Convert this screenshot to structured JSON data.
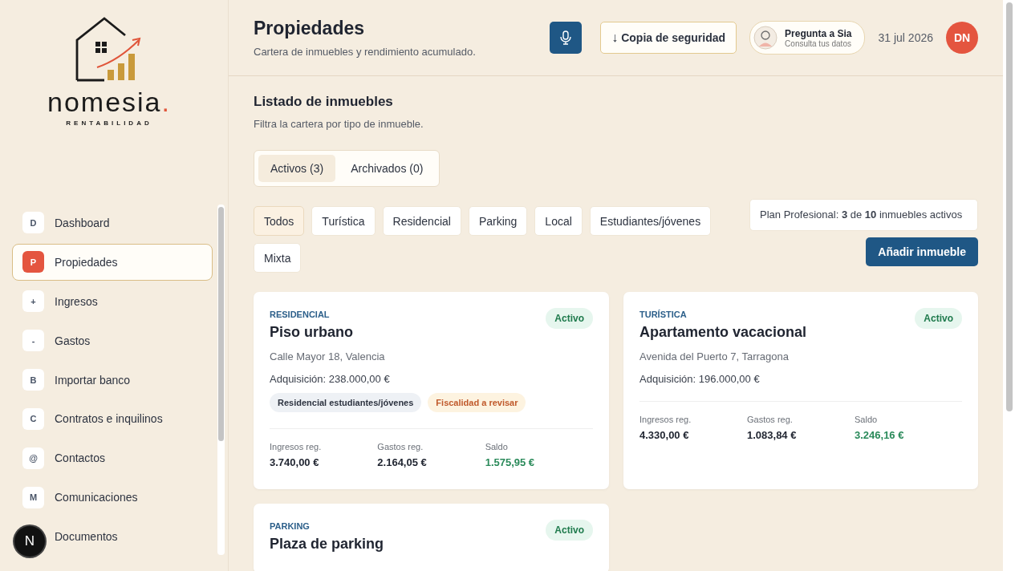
{
  "logo": {
    "name": "nomesia",
    "dot": ".",
    "tagline": "RENTABILIDAD"
  },
  "sidebar": {
    "items": [
      {
        "letter": "D",
        "label": "Dashboard",
        "selected": false
      },
      {
        "letter": "P",
        "label": "Propiedades",
        "selected": true
      },
      {
        "letter": "+",
        "label": "Ingresos",
        "selected": false
      },
      {
        "letter": "-",
        "label": "Gastos",
        "selected": false
      },
      {
        "letter": "B",
        "label": "Importar banco",
        "selected": false
      },
      {
        "letter": "C",
        "label": "Contratos e inquilinos",
        "selected": false
      },
      {
        "letter": "@",
        "label": "Contactos",
        "selected": false
      },
      {
        "letter": "M",
        "label": "Comunicaciones",
        "selected": false
      },
      {
        "label": "Documentos",
        "selected": false
      }
    ]
  },
  "dev_badge": "N",
  "header": {
    "title": "Propiedades",
    "subtitle": "Cartera de inmuebles y rendimiento acumulado.",
    "backup_button": "Copia de seguridad",
    "backup_arrow": "↓",
    "assistant": {
      "title": "Pregunta a Sia",
      "subtitle": "Consulta tus datos"
    },
    "date": "31 jul 2026",
    "user_initials": "DN"
  },
  "section": {
    "title": "Listado de inmuebles",
    "description": "Filtra la cartera por tipo de inmueble."
  },
  "tabs": [
    {
      "label": "Activos (3)",
      "selected": true
    },
    {
      "label": "Archivados (0)",
      "selected": false
    }
  ],
  "filters": [
    {
      "label": "Todos",
      "selected": true
    },
    {
      "label": "Turística",
      "selected": false
    },
    {
      "label": "Residencial",
      "selected": false
    },
    {
      "label": "Parking",
      "selected": false
    },
    {
      "label": "Local",
      "selected": false
    },
    {
      "label": "Estudiantes/jóvenes",
      "selected": false
    },
    {
      "label": "Mixta",
      "selected": false
    }
  ],
  "plan_note": "Plan Profesional: **3** de **10** inmuebles activos",
  "add_button": "Añadir inmueble",
  "properties": [
    {
      "category": "RESIDENCIAL",
      "status": "Activo",
      "name": "Piso urbano",
      "address": "Calle Mayor 18, Valencia",
      "acquisition": "Adquisición: 238.000,00 €",
      "tags": [
        {
          "label": "Residencial estudiantes/jóvenes",
          "kind": "neutral"
        },
        {
          "label": "Fiscalidad a revisar",
          "kind": "warning"
        }
      ],
      "stats": [
        {
          "label": "Ingresos reg.",
          "value": "3.740,00 €",
          "kind": "plain"
        },
        {
          "label": "Gastos reg.",
          "value": "2.164,05 €",
          "kind": "plain"
        },
        {
          "label": "Saldo",
          "value": "1.575,95 €",
          "kind": "positive"
        }
      ]
    },
    {
      "category": "TURÍSTICA",
      "status": "Activo",
      "name": "Apartamento vacacional",
      "address": "Avenida del Puerto 7, Tarragona",
      "acquisition": "Adquisición: 196.000,00 €",
      "stats": [
        {
          "label": "Ingresos reg.",
          "value": "4.330,00 €",
          "kind": "plain"
        },
        {
          "label": "Gastos reg.",
          "value": "1.083,84 €",
          "kind": "plain"
        },
        {
          "label": "Saldo",
          "value": "3.246,16 €",
          "kind": "positive"
        }
      ]
    },
    {
      "category": "PARKING",
      "status": "Activo",
      "name": "Plaza de parking"
    }
  ]
}
